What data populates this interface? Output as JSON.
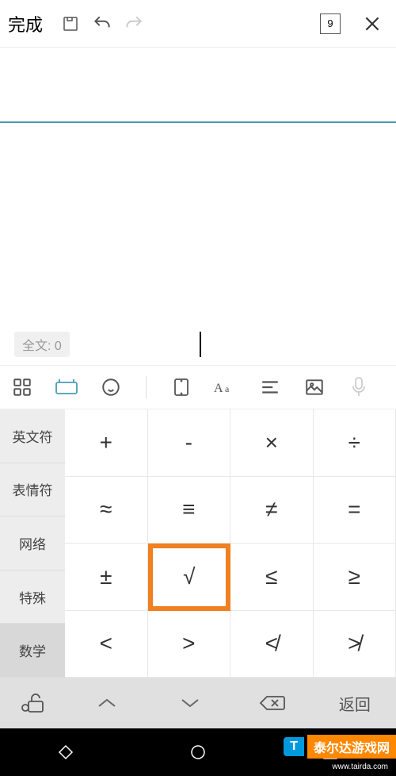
{
  "topbar": {
    "done": "完成",
    "page_number": "9"
  },
  "editor": {
    "word_count_label": "全文: 0"
  },
  "categories": [
    {
      "label": "英文符",
      "active": false
    },
    {
      "label": "表情符",
      "active": false
    },
    {
      "label": "网络",
      "active": false
    },
    {
      "label": "特殊",
      "active": false
    },
    {
      "label": "数学",
      "active": true
    }
  ],
  "symbols": [
    {
      "char": "+",
      "hl": false
    },
    {
      "char": "-",
      "hl": false
    },
    {
      "char": "×",
      "hl": false
    },
    {
      "char": "÷",
      "hl": false
    },
    {
      "char": "≈",
      "hl": false
    },
    {
      "char": "≡",
      "hl": false
    },
    {
      "char": "≠",
      "hl": false
    },
    {
      "char": "=",
      "hl": false
    },
    {
      "char": "±",
      "hl": false
    },
    {
      "char": "√",
      "hl": true
    },
    {
      "char": "≤",
      "hl": false
    },
    {
      "char": "≥",
      "hl": false
    },
    {
      "char": "<",
      "hl": false
    },
    {
      "char": ">",
      "hl": false
    },
    {
      "char": "≮",
      "hl": false
    },
    {
      "char": "≯",
      "hl": false
    }
  ],
  "bottom_row": {
    "return_label": "返回"
  },
  "watermark": {
    "text1": "T",
    "text2": "泰尔达游戏网",
    "url": "www.tairda.com"
  }
}
